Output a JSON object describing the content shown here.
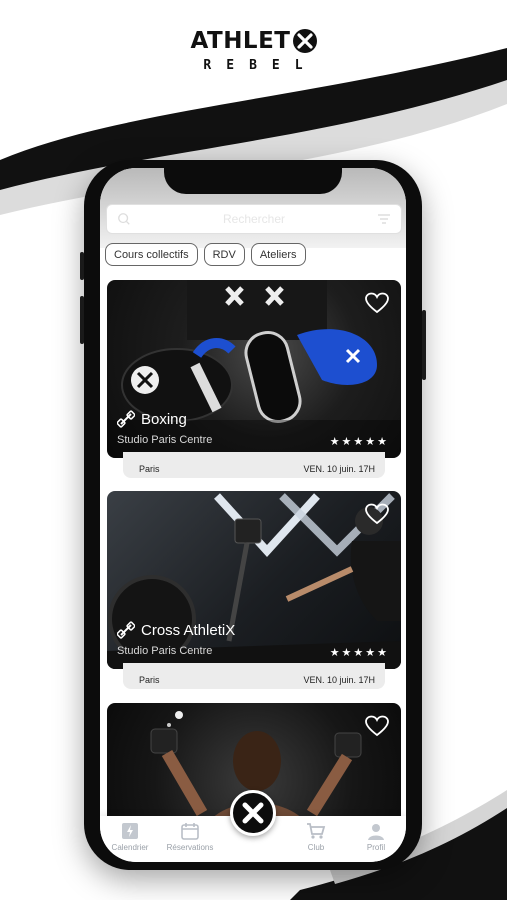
{
  "brand": {
    "name": "ATHLET",
    "sub": "REBEL"
  },
  "search": {
    "placeholder": "Rechercher"
  },
  "chips": [
    "Cours collectifs",
    "RDV",
    "Ateliers"
  ],
  "cards": [
    {
      "title": "Boxing",
      "studio": "Studio Paris Centre",
      "city": "Paris",
      "date": "VEN. 10 juin. 17H",
      "stars": "★★★★★"
    },
    {
      "title": "Cross AthletiX",
      "studio": "Studio Paris Centre",
      "city": "Paris",
      "date": "VEN. 10 juin. 17H",
      "stars": "★★★★★"
    }
  ],
  "nav": {
    "calendar": "Calendrier",
    "reservations": "Réservations",
    "club": "Club",
    "profile": "Profil"
  },
  "colors": {
    "accent": "#0c0c0c",
    "nav_inactive": "#9aa0a8",
    "card_meta_bg": "#ececec"
  }
}
